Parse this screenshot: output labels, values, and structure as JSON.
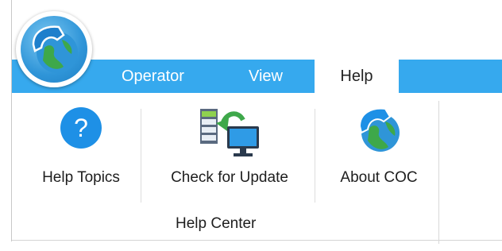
{
  "tabs": [
    {
      "label": "Operator"
    },
    {
      "label": "View"
    },
    {
      "label": "Help"
    }
  ],
  "active_tab": "Help",
  "ribbon": {
    "group_label": "Help Center",
    "buttons": [
      {
        "label": "Help Topics",
        "icon": "question-circle-icon"
      },
      {
        "label": "Check for Update",
        "icon": "update-check-icon"
      },
      {
        "label": "About COC",
        "icon": "coc-globe-phone-icon"
      }
    ]
  },
  "colors": {
    "tab_bar": "#36a9ee",
    "help_icon": "#1e90e6",
    "accent_green": "#3ea84a"
  }
}
